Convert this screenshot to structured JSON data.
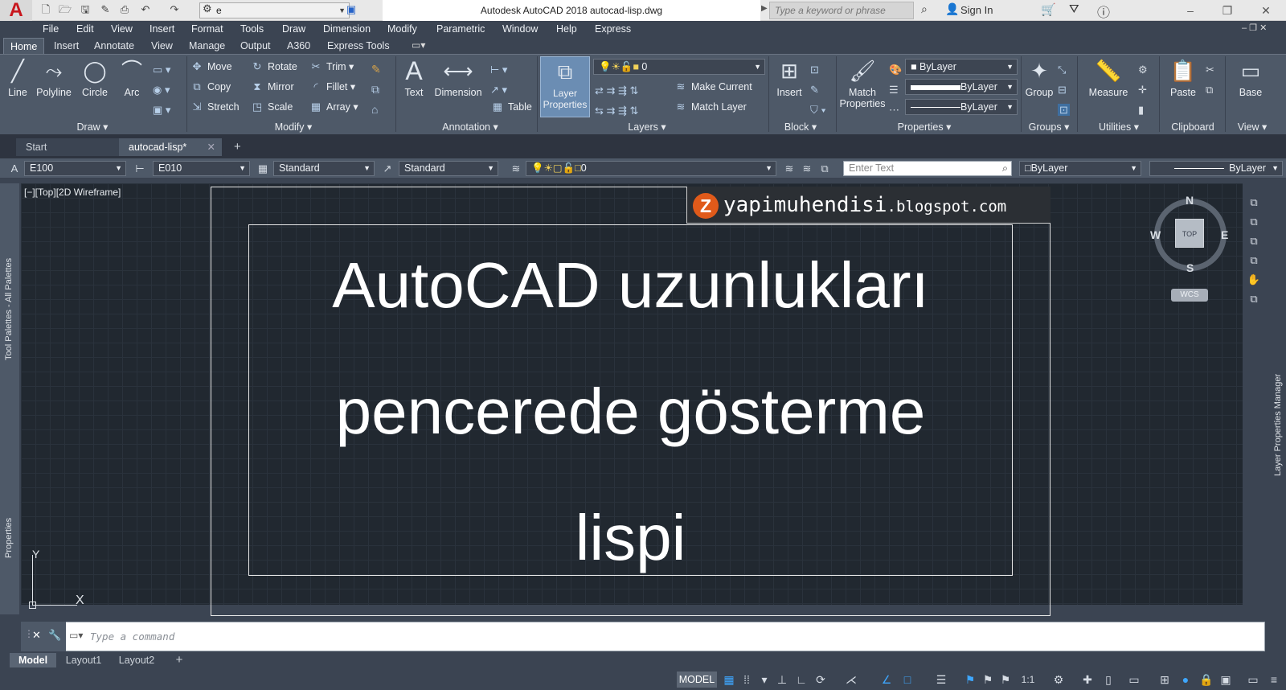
{
  "app": {
    "logo": "A",
    "window_title": "Autodesk AutoCAD 2018    autocad-lisp.dwg",
    "workspace": "e",
    "search_placeholder": "Type a keyword or phrase",
    "sign_in": "Sign In"
  },
  "menu": [
    "File",
    "Edit",
    "View",
    "Insert",
    "Format",
    "Tools",
    "Draw",
    "Dimension",
    "Modify",
    "Parametric",
    "Window",
    "Help",
    "Express"
  ],
  "ribbon_tabs": [
    "Home",
    "Insert",
    "Annotate",
    "View",
    "Manage",
    "Output",
    "A360",
    "Express Tools"
  ],
  "ribbon": {
    "draw": {
      "title": "Draw",
      "line": "Line",
      "polyline": "Polyline",
      "circle": "Circle",
      "arc": "Arc"
    },
    "modify": {
      "title": "Modify",
      "move": "Move",
      "rotate": "Rotate",
      "trim": "Trim",
      "copy": "Copy",
      "mirror": "Mirror",
      "fillet": "Fillet",
      "stretch": "Stretch",
      "scale": "Scale",
      "array": "Array"
    },
    "annotation": {
      "title": "Annotation",
      "text": "Text",
      "dimension": "Dimension",
      "table": "Table"
    },
    "layers": {
      "title": "Layers",
      "layer_properties": "Layer Properties",
      "current_layer": "0",
      "make_current": "Make Current",
      "match_layer": "Match Layer"
    },
    "block": {
      "title": "Block",
      "insert": "Insert"
    },
    "properties": {
      "title": "Properties",
      "match_properties": "Match Properties",
      "color": "ByLayer",
      "lineweight": "ByLayer",
      "linetype": "ByLayer"
    },
    "groups": {
      "title": "Groups",
      "group": "Group"
    },
    "utilities": {
      "title": "Utilities",
      "measure": "Measure"
    },
    "clipboard": {
      "title": "Clipboard",
      "paste": "Paste"
    },
    "view": {
      "title": "View",
      "base": "Base"
    }
  },
  "file_tabs": [
    "Start",
    "autocad-lisp*"
  ],
  "prop_toolbar": {
    "text_style": "E100",
    "dim_style": "E010",
    "table_style": "Standard",
    "mleader_style": "Standard",
    "layer": "0",
    "enter_text": "Enter Text",
    "color": "ByLayer",
    "linetype": "ByLayer"
  },
  "viewport": {
    "label": "[−][Top][2D Wireframe]",
    "blog_letter": "Z",
    "blog_name": "yapimuhendisi",
    "blog_domain": ".blogspot.com",
    "line1": "AutoCAD uzunlukları",
    "line2": "pencerede gösterme",
    "line3": "lispi"
  },
  "viewcube": {
    "n": "N",
    "s": "S",
    "e": "E",
    "w": "W",
    "top": "TOP",
    "wcs": "WCS"
  },
  "ucs": {
    "x": "X",
    "y": "Y"
  },
  "side_labels": {
    "tool_palettes": "Tool Palettes - All Palettes",
    "properties": "Properties",
    "layer_manager": "Layer Properties Manager"
  },
  "command": {
    "placeholder": "Type a command"
  },
  "layout_tabs": [
    "Model",
    "Layout1",
    "Layout2"
  ],
  "status": {
    "model": "MODEL",
    "scale": "1:1"
  },
  "colors": {
    "accent": "#3ea7ff",
    "ribbon": "#4e5968",
    "canvas": "#212830",
    "logo_red": "#c8161d",
    "blog_orange": "#e05a1a"
  }
}
